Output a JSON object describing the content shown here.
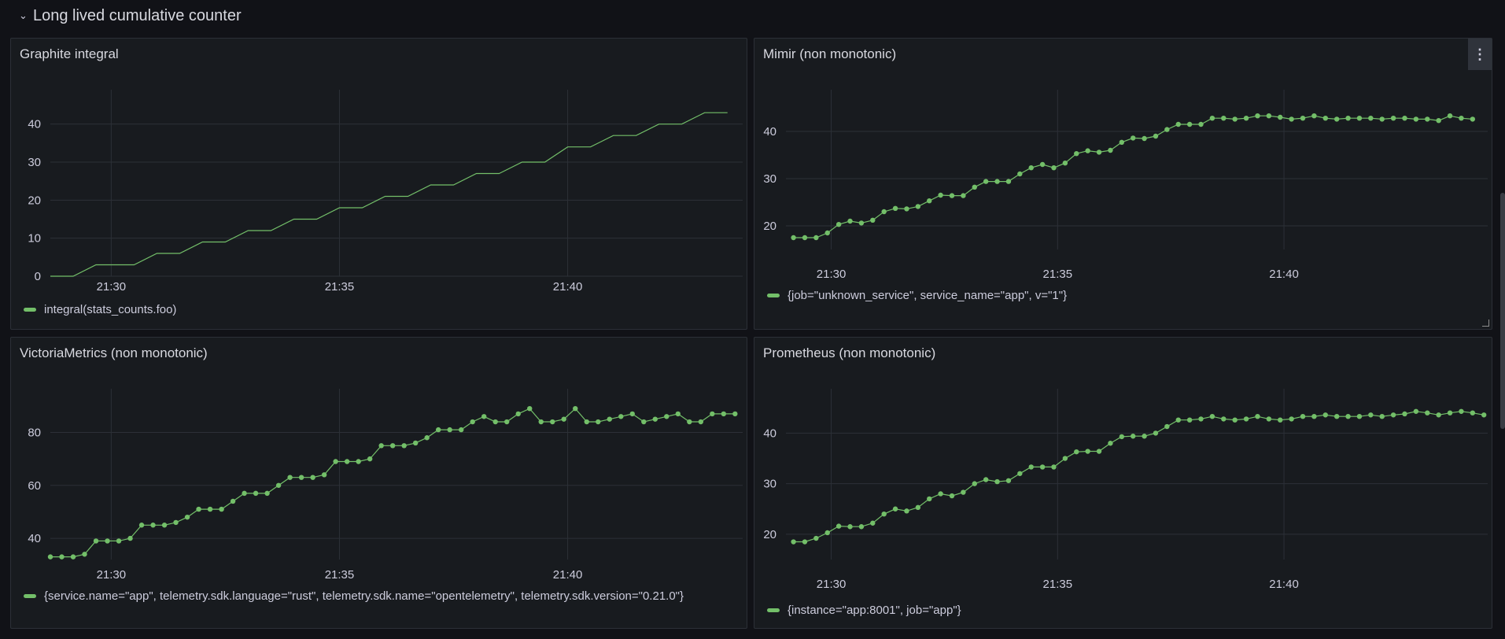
{
  "row": {
    "chevron": "⌄",
    "title": "Long lived cumulative counter"
  },
  "theme": {
    "series_color": "#73bf69",
    "grid_color": "#2c3037",
    "bg": "#181b1f"
  },
  "panels": [
    {
      "title": "Graphite integral",
      "legend": "integral(stats_counts.foo)",
      "chart_data": {
        "type": "line",
        "style": "step-line",
        "points_visible": false,
        "x_ticks": [
          "21:30",
          "21:35",
          "21:40"
        ],
        "y_ticks": [
          0,
          10,
          20,
          30,
          40
        ],
        "ylim": [
          0,
          48
        ],
        "x": [
          "21:28:40",
          "21:29:10",
          "21:29:40",
          "21:30:30",
          "21:31:00",
          "21:31:30",
          "21:32:00",
          "21:32:30",
          "21:33:00",
          "21:33:30",
          "21:34:00",
          "21:34:30",
          "21:35:00",
          "21:35:30",
          "21:36:00",
          "21:36:30",
          "21:37:00",
          "21:37:30",
          "21:38:00",
          "21:38:30",
          "21:39:00",
          "21:39:30",
          "21:40:00",
          "21:40:30",
          "21:41:00",
          "21:41:30",
          "21:42:00",
          "21:42:30",
          "21:43:00",
          "21:43:30"
        ],
        "series": [
          {
            "name": "integral(stats_counts.foo)",
            "values": [
              0,
              0,
              3,
              3,
              6,
              6,
              9,
              9,
              12,
              12,
              15,
              15,
              18,
              18,
              21,
              21,
              24,
              24,
              27,
              27,
              30,
              30,
              34,
              34,
              37,
              37,
              40,
              40,
              43,
              43
            ]
          }
        ]
      }
    },
    {
      "title": "Mimir (non monotonic)",
      "legend": "{job=\"unknown_service\", service_name=\"app\", v=\"1\"}",
      "menu_icon": "⋮",
      "chart_data": {
        "type": "line",
        "points_visible": true,
        "x_ticks": [
          "21:30",
          "21:35",
          "21:40"
        ],
        "y_ticks": [
          20,
          30,
          40
        ],
        "ylim": [
          15,
          48
        ],
        "x_start": "21:29:10",
        "x_step_seconds": 15,
        "series": [
          {
            "name": "{job=\"unknown_service\", service_name=\"app\", v=\"1\"}",
            "values": [
              17.5,
              17.5,
              17.5,
              18.5,
              20.3,
              21,
              20.6,
              21.2,
              23,
              23.7,
              23.6,
              24.1,
              25.3,
              26.5,
              26.4,
              26.4,
              28.2,
              29.4,
              29.4,
              29.4,
              31,
              32.3,
              33,
              32.3,
              33.3,
              35.3,
              35.9,
              35.6,
              36,
              37.7,
              38.6,
              38.5,
              39,
              40.4,
              41.5,
              41.5,
              41.5,
              42.8,
              42.8,
              42.6,
              42.8,
              43.3,
              43.3,
              43,
              42.6,
              42.8,
              43.3,
              42.8,
              42.6,
              42.8,
              42.8,
              42.8,
              42.6,
              42.8,
              42.8,
              42.6,
              42.6,
              42.3,
              43.3,
              42.8,
              42.6
            ]
          }
        ]
      }
    },
    {
      "title": "VictoriaMetrics (non monotonic)",
      "legend": "{service.name=\"app\", telemetry.sdk.language=\"rust\", telemetry.sdk.name=\"opentelemetry\", telemetry.sdk.version=\"0.21.0\"}",
      "chart_data": {
        "type": "line",
        "points_visible": true,
        "x_ticks": [
          "21:30",
          "21:35",
          "21:40"
        ],
        "y_ticks": [
          40,
          60,
          80
        ],
        "ylim": [
          32,
          95
        ],
        "x_start": "21:28:40",
        "x_step_seconds": 15,
        "series": [
          {
            "name": "{service.name=\"app\", telemetry.sdk.language=\"rust\", telemetry.sdk.name=\"opentelemetry\", telemetry.sdk.version=\"0.21.0\"}",
            "values": [
              33,
              33,
              33,
              34,
              39,
              39,
              39,
              40,
              45,
              45,
              45,
              46,
              48,
              51,
              51,
              51,
              54,
              57,
              57,
              57,
              60,
              63,
              63,
              63,
              64,
              69,
              69,
              69,
              70,
              75,
              75,
              75,
              76,
              78,
              81,
              81,
              81,
              84,
              86,
              84,
              84,
              87,
              89,
              84,
              84,
              85,
              89,
              84,
              84,
              85,
              86,
              87,
              84,
              85,
              86,
              87,
              84,
              84,
              87,
              87,
              87
            ]
          }
        ]
      }
    },
    {
      "title": "Prometheus (non monotonic)",
      "legend": "{instance=\"app:8001\", job=\"app\"}",
      "chart_data": {
        "type": "line",
        "points_visible": true,
        "x_ticks": [
          "21:30",
          "21:35",
          "21:40"
        ],
        "y_ticks": [
          20,
          30,
          40
        ],
        "ylim": [
          15,
          48
        ],
        "x_start": "21:29:10",
        "x_step_seconds": 15,
        "series": [
          {
            "name": "{instance=\"app:8001\", job=\"app\"}",
            "values": [
              18.5,
              18.5,
              19.2,
              20.3,
              21.6,
              21.5,
              21.5,
              22.2,
              24,
              25,
              24.6,
              25.3,
              27,
              28,
              27.6,
              28.3,
              30,
              30.8,
              30.4,
              30.6,
              32,
              33.3,
              33.3,
              33.3,
              35,
              36.3,
              36.4,
              36.4,
              38,
              39.3,
              39.4,
              39.4,
              40,
              41.3,
              42.6,
              42.6,
              42.8,
              43.3,
              42.8,
              42.6,
              42.8,
              43.3,
              42.8,
              42.6,
              42.8,
              43.3,
              43.3,
              43.6,
              43.3,
              43.3,
              43.3,
              43.6,
              43.3,
              43.6,
              43.8,
              44.3,
              44,
              43.6,
              44,
              44.3,
              44,
              43.6
            ]
          }
        ]
      }
    }
  ]
}
